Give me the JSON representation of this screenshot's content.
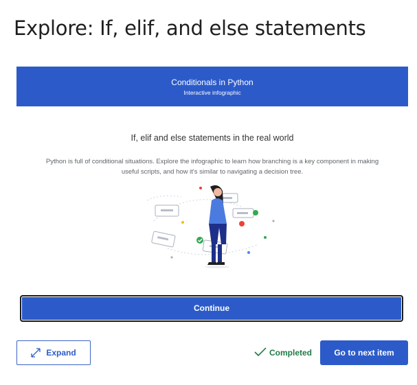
{
  "page": {
    "title": "Explore: If, elif, and else statements"
  },
  "infographic": {
    "banner_title": "Conditionals in Python",
    "banner_subtitle": "Interactive infographic",
    "heading": "If, elif and else statements in the real world",
    "description": "Python is full of conditional situations. Explore the infographic to learn how branching is a key component in making useful scripts, and how it's similar to navigating a decision tree.",
    "illustration_icon": "woman-decision-tree-illustration",
    "continue_label": "Continue",
    "banner_color": "#2c5bc9"
  },
  "footer": {
    "expand_label": "Expand",
    "expand_icon": "expand-arrows-icon",
    "completed_label": "Completed",
    "completed_icon": "checkmark-icon",
    "next_label": "Go to next item",
    "accent_color": "#2c5bc9",
    "completed_color": "#1f7a45"
  }
}
